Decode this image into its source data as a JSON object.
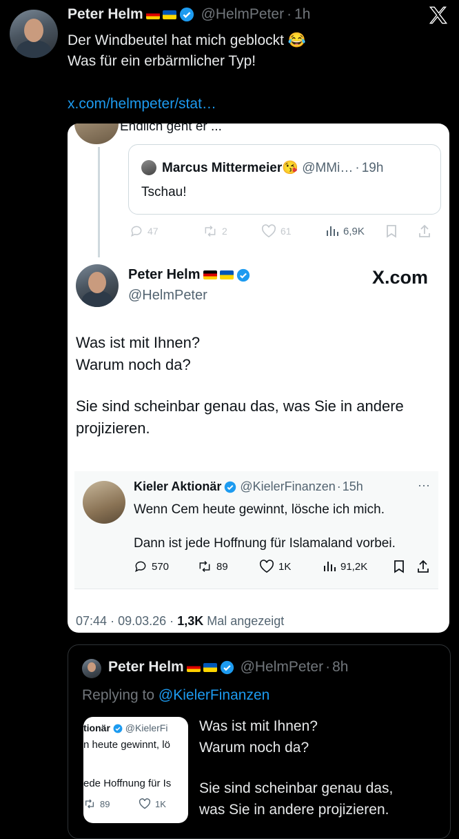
{
  "top_tweet": {
    "name": "Peter Helm",
    "handle": "@HelmPeter",
    "sep": "·",
    "time": "1h",
    "line1": "Der Windbeutel hat mich geblockt",
    "emoji": "😂",
    "line2": "Was für ein erbärmlicher Typ!",
    "link": "x.com/helmpeter/stat…",
    "platform_logo": "X"
  },
  "embed": {
    "prev_text": "Endlich geht er ...",
    "quoted": {
      "name": "Marcus Mittermeier",
      "emoji": "😘",
      "handle": "@MMi…",
      "sep": "·",
      "time": "19h",
      "text": "Tschau!"
    },
    "faded_stats": {
      "replies": "47",
      "retweets": "2",
      "likes": "61",
      "views": "6,9K"
    },
    "main": {
      "name": "Peter Helm",
      "handle": "@HelmPeter",
      "brand": "X.com",
      "line1": "Was ist mit Ihnen?",
      "line2": "Warum noch da?",
      "line3": "Sie sind scheinbar genau das, was Sie in andere",
      "line4": "projizieren."
    },
    "inner_quote": {
      "name": "Kieler Aktionär",
      "handle": "@KielerFinanzen",
      "sep": "·",
      "time": "15h",
      "more": "···",
      "line1": "Wenn Cem heute gewinnt, lösche ich mich.",
      "line2": "Dann ist jede Hoffnung für Islamaland vorbei.",
      "replies": "570",
      "retweets": "89",
      "likes": "1K",
      "views": "91,2K"
    },
    "footer": {
      "time": "07:44",
      "sep1": "·",
      "date": "09.03.26",
      "sep2": "·",
      "views": "1,3K",
      "suffix": "Mal angezeigt"
    }
  },
  "reply_card": {
    "name": "Peter Helm",
    "handle": "@HelmPeter",
    "sep": "·",
    "time": "8h",
    "replying_prefix": "Replying to",
    "replying_handle": "@KielerFinanzen",
    "thumb": {
      "name": "tionär",
      "handle": "@KielerFi",
      "line1": "n heute gewinnt, lö",
      "line2": "ede Hoffnung für Is",
      "retweets": "89",
      "likes": "1K"
    },
    "line1": "Was ist mit Ihnen?",
    "line2": "Warum noch da?",
    "line3": "Sie sind scheinbar genau das,",
    "line4": "was Sie in andere projizieren."
  },
  "colors": {
    "link": "#1d9bf0",
    "verified": "#1d9bf0",
    "background": "#000000"
  }
}
